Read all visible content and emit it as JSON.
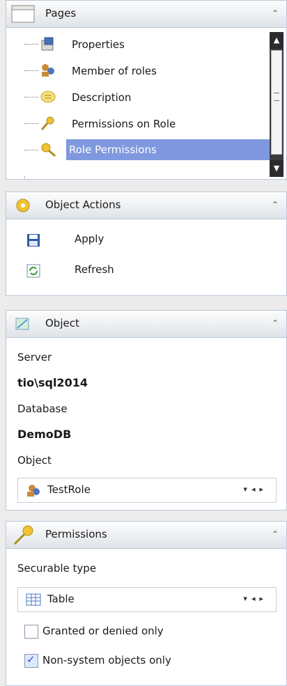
{
  "pages": {
    "title": "Pages",
    "items": [
      {
        "label": "Properties",
        "icon": "properties-icon"
      },
      {
        "label": "Member of roles",
        "icon": "roles-icon"
      },
      {
        "label": "Description",
        "icon": "description-icon"
      },
      {
        "label": "Permissions on Role",
        "icon": "key-icon"
      },
      {
        "label": "Role Permissions",
        "icon": "role-permissions-icon",
        "selected": true
      }
    ]
  },
  "object_actions": {
    "title": "Object Actions",
    "apply_label": "Apply",
    "refresh_label": "Refresh"
  },
  "object": {
    "title": "Object",
    "server_label": "Server",
    "server_value": "tio\\sql2014",
    "database_label": "Database",
    "database_value": "DemoDB",
    "object_label": "Object",
    "object_value": "TestRole"
  },
  "permissions": {
    "title": "Permissions",
    "securable_type_label": "Securable type",
    "securable_type_value": "Table",
    "granted_only_label": "Granted or denied only",
    "granted_only_checked": false,
    "non_system_label": "Non-system objects only",
    "non_system_checked": true
  }
}
